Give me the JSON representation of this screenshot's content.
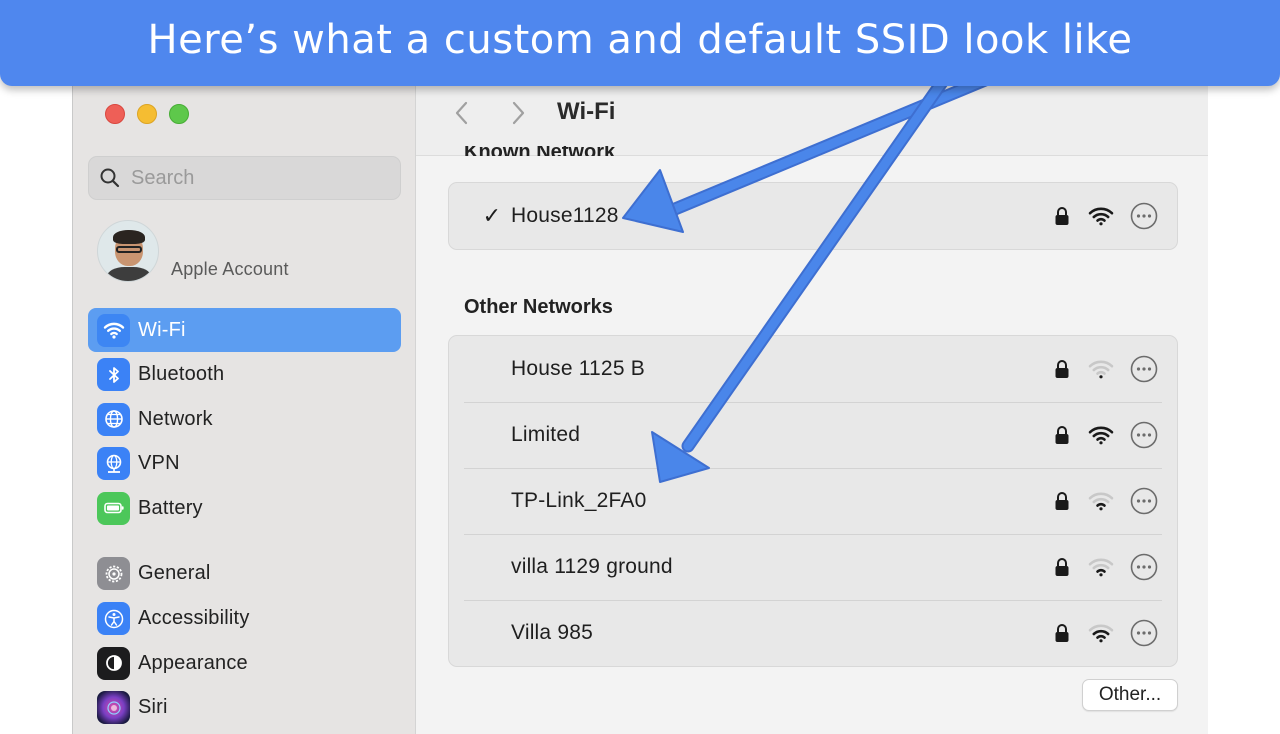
{
  "banner": {
    "text": "Here’s what a custom and default SSID look like"
  },
  "sidebar": {
    "search_placeholder": "Search",
    "account_label": "Apple Account",
    "items": [
      {
        "label": "Wi-Fi",
        "icon": "wifi-icon",
        "color": "#3b82f6",
        "active": true
      },
      {
        "label": "Bluetooth",
        "icon": "bluetooth-icon",
        "color": "#3b82f6"
      },
      {
        "label": "Network",
        "icon": "globe-icon",
        "color": "#3b82f6"
      },
      {
        "label": "VPN",
        "icon": "vpn-globe-icon",
        "color": "#3b82f6"
      },
      {
        "label": "Battery",
        "icon": "battery-icon",
        "color": "#4cc75a"
      },
      {
        "label": "General",
        "icon": "gear-icon",
        "color": "#8e8e93"
      },
      {
        "label": "Accessibility",
        "icon": "accessibility-icon",
        "color": "#3b82f6"
      },
      {
        "label": "Appearance",
        "icon": "appearance-icon",
        "color": "#1c1c1e"
      },
      {
        "label": "Siri",
        "icon": "siri-icon",
        "color": "#7a3fc4"
      }
    ]
  },
  "toolbar": {
    "title": "Wi-Fi"
  },
  "known": {
    "header": "Known Network",
    "networks": [
      {
        "name": "House1128",
        "connected": true,
        "signal": "strong"
      }
    ]
  },
  "other": {
    "header": "Other Networks",
    "networks": [
      {
        "name": "House 1125 B",
        "signal": "weak"
      },
      {
        "name": "Limited",
        "signal": "strong"
      },
      {
        "name": "TP-Link_2FA0",
        "signal": "weak"
      },
      {
        "name": "villa 1129 ground",
        "signal": "weak"
      },
      {
        "name": "Villa 985",
        "signal": "strong"
      }
    ],
    "other_button": "Other..."
  },
  "colors": {
    "accent": "#5c9df1",
    "banner": "#4f87ee",
    "arrow": "#4a86ea"
  }
}
